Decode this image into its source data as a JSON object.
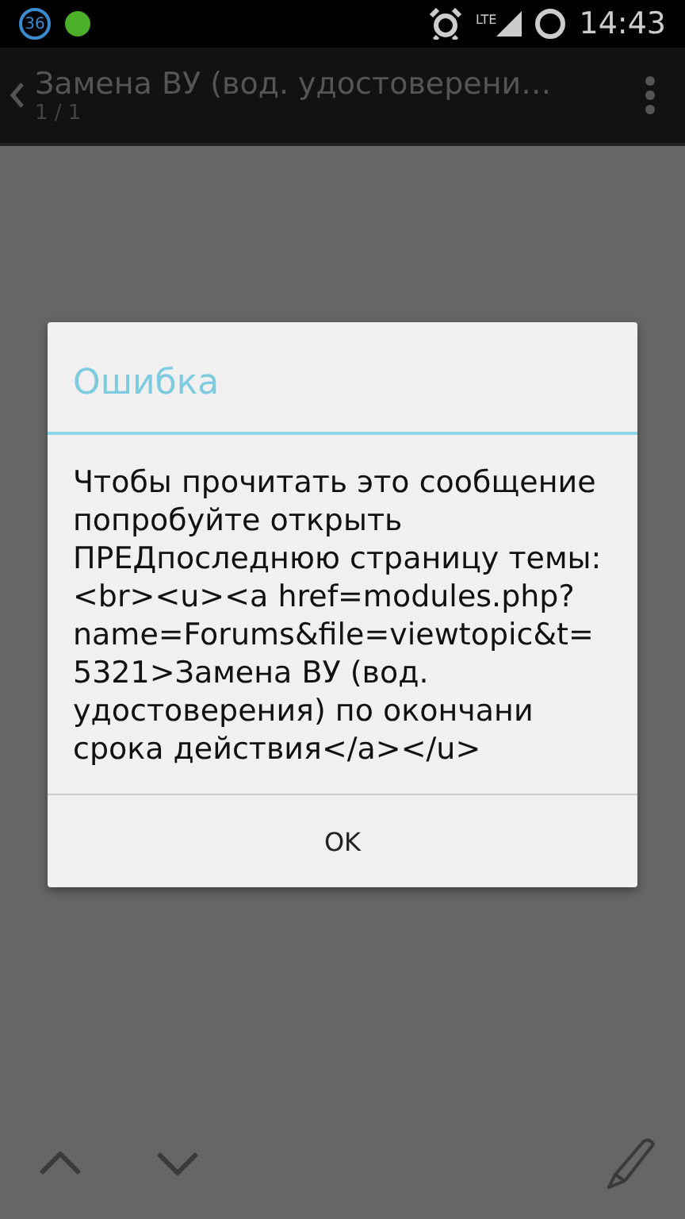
{
  "status_bar": {
    "notification_count": "36",
    "time": "14:43",
    "network": "LTE"
  },
  "action_bar": {
    "title": "Замена ВУ (вод. удостоверени…",
    "subtitle": "1 / 1"
  },
  "dialog": {
    "title": "Ошибка",
    "message": "Чтобы прочитать это сообщение попробуйте открыть ПРЕДпоследнюю страницу темы:<br><u><a href=modules.php?name=Forums&file=viewtopic&t=5321>Замена ВУ (вод. удостоверения) по окончани срока действия</a></u>",
    "buttons": [
      "OK"
    ]
  }
}
